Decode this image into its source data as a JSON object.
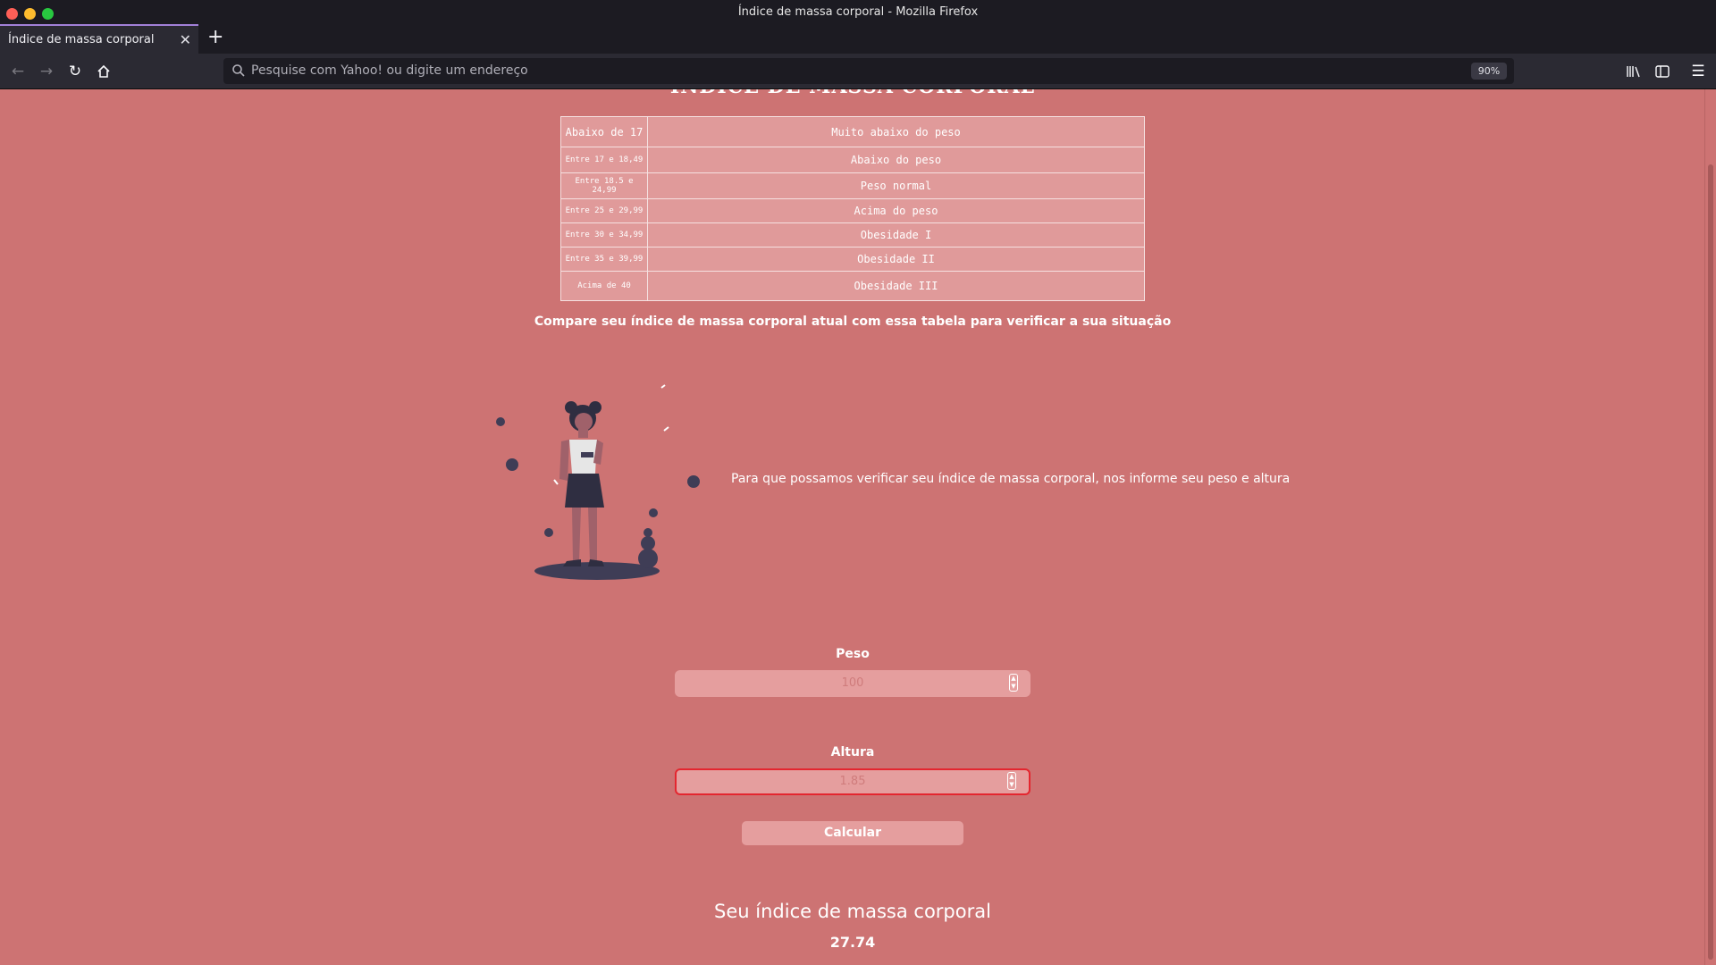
{
  "window": {
    "title": "Índice de massa corporal - Mozilla Firefox"
  },
  "browser": {
    "tab_title": "Índice de massa corporal",
    "url_placeholder": "Pesquise com Yahoo! ou digite um endereço",
    "zoom": "90%"
  },
  "page": {
    "heading": "ÍNDICE DE MASSA CORPORAL",
    "table": [
      {
        "range": "Abaixo de 17",
        "category": "Muito abaixo do peso"
      },
      {
        "range": "Entre 17 e 18,49",
        "category": "Abaixo do peso"
      },
      {
        "range": "Entre 18.5 e 24,99",
        "category": "Peso normal"
      },
      {
        "range": "Entre 25 e 29,99",
        "category": "Acima do peso"
      },
      {
        "range": "Entre 30 e 34,99",
        "category": "Obesidade I"
      },
      {
        "range": "Entre 35 e 39,99",
        "category": "Obesidade II"
      },
      {
        "range": "Acima de 40",
        "category": "Obesidade III"
      }
    ],
    "compare_text": "Compare seu índice de massa corporal atual com essa tabela para verificar a sua situação",
    "info_text": "Para que possamos verificar seu índice de massa corporal, nos informe seu peso e altura",
    "form": {
      "peso_label": "Peso",
      "peso_value": "100",
      "altura_label": "Altura",
      "altura_value": "1.85",
      "button_label": "Calcular"
    },
    "result": {
      "title": "Seu índice de massa corporal",
      "value": "27.74"
    }
  },
  "colors": {
    "page_bg": "#cd7373",
    "input_bg": "#e59e9e",
    "error_border": "#e4262f",
    "figure_dark": "#3f3d56"
  }
}
